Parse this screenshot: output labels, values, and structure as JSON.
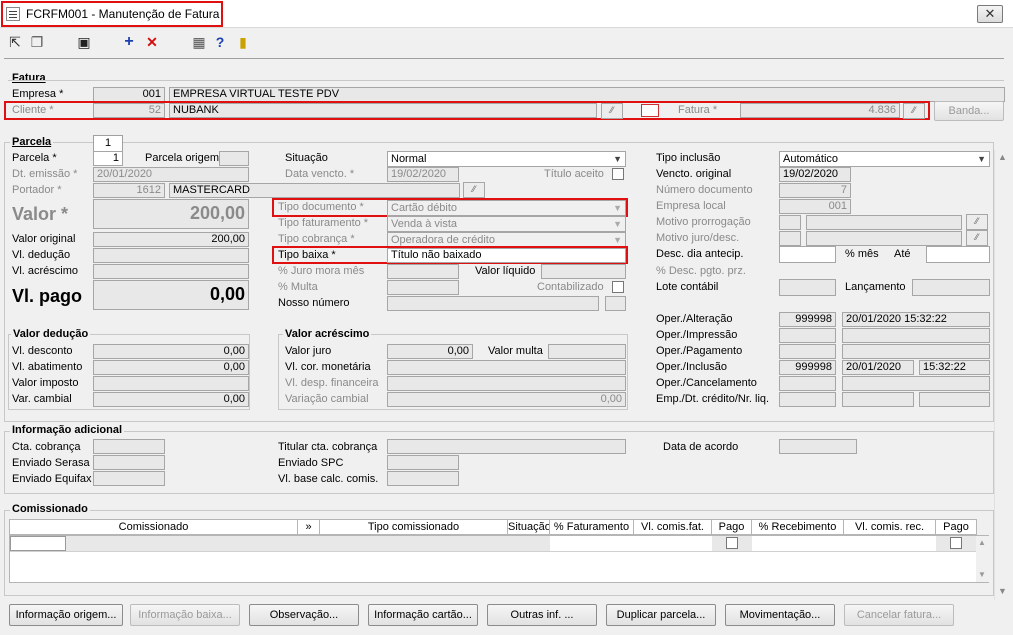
{
  "window": {
    "title": "FCRFM001 - Manutenção de Fatura",
    "close_icon": "close-icon"
  },
  "toolbar": {
    "icons": [
      "first-record-icon",
      "copy-icon",
      "save-icon",
      "add-icon",
      "delete-icon",
      "calculator-icon",
      "help-icon",
      "exit-icon"
    ]
  },
  "fatura": {
    "section_label": "Fatura",
    "empresa_label": "Empresa *",
    "empresa_code": "001",
    "empresa_name": "EMPRESA VIRTUAL TESTE PDV",
    "cliente_label": "Cliente *",
    "cliente_code": "52",
    "cliente_name": "NUBANK",
    "fatura_label": "Fatura *",
    "fatura_value": "4.836",
    "banda_label": "Banda..."
  },
  "parcela": {
    "section_label": "Parcela",
    "tab_label": "1",
    "parcela_label": "Parcela *",
    "parcela_value": "1",
    "parcela_origem_label": "Parcela origem",
    "dt_emissao_label": "Dt. emissão *",
    "dt_emissao_value": "20/01/2020",
    "portador_label": "Portador *",
    "portador_code": "1612",
    "portador_name": "MASTERCARD",
    "valor_label": "Valor *",
    "valor_value": "200,00",
    "valor_original_label": "Valor original",
    "valor_original_value": "200,00",
    "vl_deducao_label": "Vl. dedução",
    "vl_acrescimo_label": "Vl. acréscimo",
    "vl_pago_label": "Vl. pago",
    "vl_pago_value": "0,00",
    "situacao_label": "Situação",
    "situacao_value": "Normal",
    "data_vencto_label": "Data vencto. *",
    "data_vencto_value": "19/02/2020",
    "titulo_aceito_label": "Título aceito",
    "tipo_documento_label": "Tipo documento *",
    "tipo_documento_value": "Cartão débito",
    "tipo_faturamento_label": "Tipo faturamento *",
    "tipo_faturamento_value": "Venda à vista",
    "tipo_cobranca_label": "Tipo cobrança *",
    "tipo_cobranca_value": "Operadora de crédito",
    "tipo_baixa_label": "Tipo baixa *",
    "tipo_baixa_value": "Título não baixado",
    "juro_mora_label": "% Juro mora mês",
    "valor_liquido_label": "Valor líquido",
    "multa_label": "% Multa",
    "contabilizado_label": "Contabilizado",
    "nosso_numero_label": "Nosso número",
    "tipo_inclusao_label": "Tipo inclusão",
    "tipo_inclusao_value": "Automático",
    "vencto_original_label": "Vencto. original",
    "vencto_original_value": "19/02/2020",
    "numero_documento_label": "Número documento",
    "numero_documento_value": "7",
    "empresa_local_label": "Empresa local",
    "empresa_local_value": "001",
    "motivo_prorrogacao_label": "Motivo prorrogação",
    "motivo_juro_label": "Motivo juro/desc.",
    "desc_dia_label": "Desc. dia antecip.",
    "pct_mes_label": "% mês",
    "ate_label": "Até",
    "desc_pgto_label": "% Desc. pgto. prz.",
    "lote_contabil_label": "Lote contábil",
    "lancamento_label": "Lançamento"
  },
  "valor_deducao": {
    "section_label": "Valor dedução",
    "desconto_label": "Vl. desconto",
    "desconto_value": "0,00",
    "abatimento_label": "Vl. abatimento",
    "abatimento_value": "0,00",
    "imposto_label": "Valor imposto",
    "var_cambial_label": "Var. cambial",
    "var_cambial_value": "0,00"
  },
  "valor_acrescimo": {
    "section_label": "Valor acréscimo",
    "juro_label": "Valor juro",
    "juro_value": "0,00",
    "multa_label": "Valor multa",
    "cor_monetaria_label": "Vl. cor. monetária",
    "desp_financeira_label": "Vl. desp. financeira",
    "variacao_cambial_label": "Variação cambial",
    "variacao_cambial_value": "0,00"
  },
  "operacoes": {
    "alteracao_label": "Oper./Alteração",
    "alteracao_user": "999998",
    "alteracao_datetime": "20/01/2020 15:32:22",
    "impressao_label": "Oper./Impressão",
    "pagamento_label": "Oper./Pagamento",
    "inclusao_label": "Oper./Inclusão",
    "inclusao_user": "999998",
    "inclusao_date": "20/01/2020",
    "inclusao_time": "15:32:22",
    "cancelamento_label": "Oper./Cancelamento",
    "emp_dt_credito_label": "Emp./Dt. crédito/Nr. liq."
  },
  "info_adicional": {
    "section_label": "Informação adicional",
    "cta_cobranca_label": "Cta. cobrança",
    "enviado_serasa_label": "Enviado Serasa",
    "enviado_equifax_label": "Enviado Equifax",
    "titular_label": "Titular cta. cobrança",
    "enviado_spc_label": "Enviado SPC",
    "vl_base_label": "Vl. base calc. comis.",
    "data_acordo_label": "Data de acordo"
  },
  "comissionado": {
    "section_label": "Comissionado",
    "columns": [
      "Comissionado",
      "»",
      "Tipo comissionado",
      "Situação",
      "% Faturamento",
      "Vl. comis.fat.",
      "Pago",
      "% Recebimento",
      "Vl. comis. rec.",
      "Pago"
    ]
  },
  "buttons": {
    "info_origem": "Informação origem...",
    "info_baixa": "Informação baixa...",
    "observacao": "Observação...",
    "info_cartao": "Informação cartão...",
    "outras_inf": "Outras inf. ...",
    "duplicar_parcela": "Duplicar parcela...",
    "movimentacao": "Movimentação...",
    "cancelar_fatura": "Cancelar fatura..."
  },
  "colors": {
    "highlight_border": "#e01010",
    "disabled_text": "#8a8a8a",
    "field_bg": "#e8e8e8"
  }
}
